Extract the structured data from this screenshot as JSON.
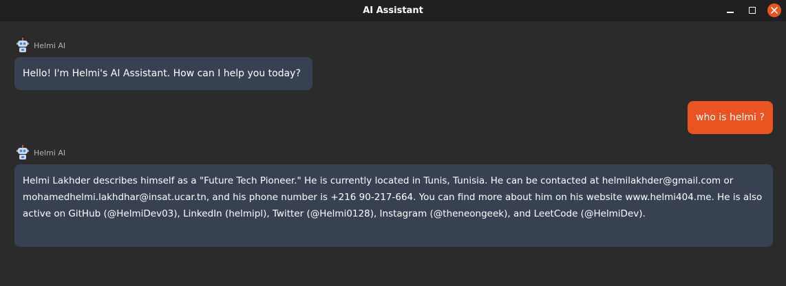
{
  "window": {
    "title": "AI Assistant",
    "controls": [
      "minimize-icon",
      "maximize-icon",
      "close-icon"
    ],
    "accent_color": "#e95420"
  },
  "messages": [
    {
      "role": "bot",
      "sender": "Helmi AI",
      "avatar_icon": "robot-icon",
      "text": "Hello! I'm Helmi's AI Assistant. How can I help you today?"
    },
    {
      "role": "user",
      "text": "who is helmi ?"
    },
    {
      "role": "bot",
      "sender": "Helmi AI",
      "avatar_icon": "robot-icon",
      "text": "Helmi Lakhder describes himself as a \"Future Tech Pioneer.\" He is currently located in Tunis, Tunisia. He can be contacted at helmilakhder@gmail.com or mohamedhelmi.lakhdhar@insat.ucar.tn, and his phone number is +216 90-217-664. You can find more about him on his website www.helmi404.me. He is also active on GitHub (@HelmiDev03), LinkedIn (helmipl), Twitter (@Helmi0128), Instagram (@theneongeek), and LeetCode (@HelmiDev)."
    }
  ]
}
